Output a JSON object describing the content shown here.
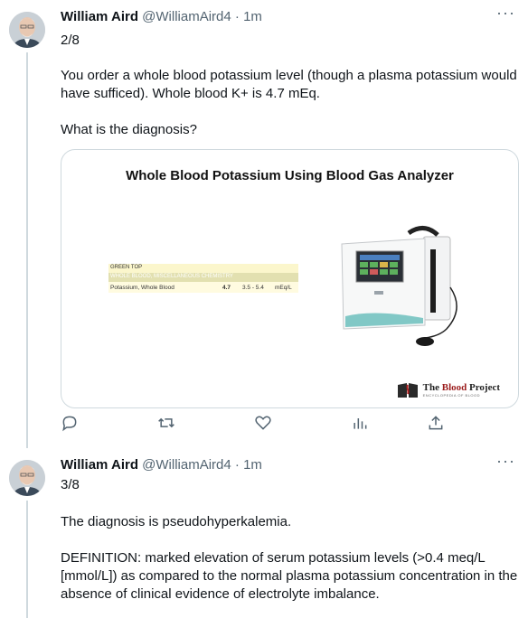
{
  "tweets": [
    {
      "author_name": "William Aird",
      "handle": "@WilliamAird4",
      "time": "1m",
      "separator": "·",
      "more_label": "···",
      "thread_index": "2/8",
      "paragraphs": [
        "You order a whole blood potassium level (though a plasma potassium would have sufficed). Whole blood K+ is 4.7 mEq.",
        "What is the diagnosis?"
      ],
      "media": {
        "title": "Whole Blood Potassium Using Blood Gas Analyzer",
        "lab_table": {
          "header1": "GREEN TOP",
          "header2": "WHOLE BLOOD, MISCELLANEOUS CHEMISTRY",
          "row": {
            "test": "Potassium, Whole Blood",
            "value": "4.7",
            "range": "3.5 - 5.4",
            "units": "mEq/L"
          }
        },
        "brand": {
          "prefix": "The ",
          "highlight": "Blood",
          "suffix": " Project",
          "subtitle": "ENCYCLOPEDIA OF BLOOD"
        }
      },
      "actions": [
        "reply-icon",
        "retweet-icon",
        "like-icon",
        "views-icon",
        "share-icon"
      ]
    },
    {
      "author_name": "William Aird",
      "handle": "@WilliamAird4",
      "time": "1m",
      "separator": "·",
      "more_label": "···",
      "thread_index": "3/8",
      "paragraphs": [
        "The diagnosis is pseudohyperkalemia.",
        "DEFINITION: marked elevation of serum potassium levels (>0.4 meq/L [mmol/L]) as compared to the normal plasma potassium concentration in the absence of clinical evidence of electrolyte imbalance."
      ]
    }
  ],
  "colors": {
    "text": "#0f1419",
    "secondary": "#536471",
    "border": "#cfd9de",
    "brand_red": "#9b1c1c"
  }
}
